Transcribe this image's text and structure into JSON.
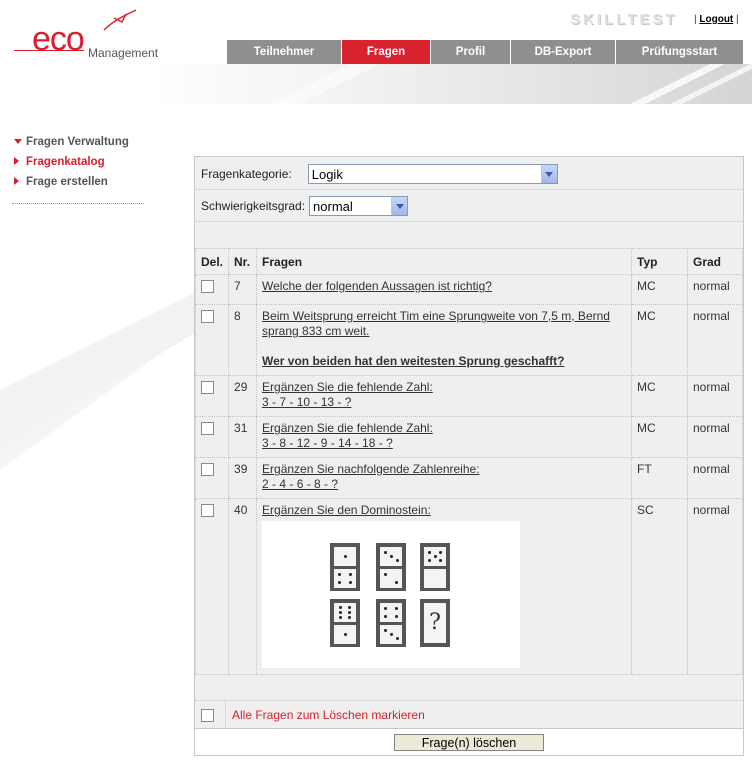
{
  "brand": {
    "logo_main": "eco",
    "logo_sub": "Management",
    "app_name": "SKILLTEST",
    "logout_label": "Logout",
    "logout_prefix": "|",
    "logout_suffix": "|"
  },
  "nav": {
    "tabs": [
      {
        "label": "Teilnehmer",
        "active": false
      },
      {
        "label": "Fragen",
        "active": true
      },
      {
        "label": "Profil",
        "active": false
      },
      {
        "label": "DB-Export",
        "active": false
      },
      {
        "label": "Prüfungsstart",
        "active": false
      }
    ]
  },
  "sidebar": {
    "items": [
      {
        "label": "Fragen Verwaltung"
      },
      {
        "label": "Fragenkatalog"
      },
      {
        "label": "Frage erstellen"
      }
    ]
  },
  "filters": {
    "category_label": "Fragenkategorie:",
    "category_value": "Logik",
    "difficulty_label": "Schwierigkeitsgrad:",
    "difficulty_value": "normal"
  },
  "table": {
    "headers": {
      "del": "Del.",
      "nr": "Nr.",
      "question": "Fragen",
      "type": "Typ",
      "grade": "Grad"
    },
    "rows": [
      {
        "nr": "7",
        "line1": "Welche der folgenden Aussagen ist richtig?",
        "line2": "",
        "bold": "",
        "type": "MC",
        "grade": "normal"
      },
      {
        "nr": "8",
        "line1": "Beim Weitsprung erreicht Tim eine Sprungweite von 7,5 m, Bernd sprang 833 cm weit.",
        "line2": "",
        "bold": "Wer von beiden hat den weitesten Sprung geschafft?",
        "type": "MC",
        "grade": "normal"
      },
      {
        "nr": "29",
        "line1": "Ergänzen Sie die fehlende Zahl:",
        "line2": "3 - 7 - 10 - 13 - ?",
        "bold": "",
        "type": "MC",
        "grade": "normal"
      },
      {
        "nr": "31",
        "line1": "Ergänzen Sie die fehlende Zahl:",
        "line2": "3 - 8 - 12 - 9 - 14 - 18 - ?",
        "bold": "",
        "type": "MC",
        "grade": "normal"
      },
      {
        "nr": "39",
        "line1": "Ergänzen Sie nachfolgende Zahlenreihe:",
        "line2": "2 - 4 - 6 - 8 - ?",
        "bold": "",
        "type": "FT",
        "grade": "normal"
      },
      {
        "nr": "40",
        "line1": "Ergänzen Sie den Dominostein:",
        "line2": "",
        "bold": "",
        "type": "SC",
        "grade": "normal",
        "domino_unknown": "?"
      }
    ]
  },
  "actions": {
    "mark_all_label": "Alle Fragen zum Löschen markieren",
    "delete_button": "Frage(n) löschen"
  },
  "colors": {
    "accent": "#d6202d",
    "tab_inactive": "#8f8f8f",
    "panel_bg": "#efefef"
  }
}
